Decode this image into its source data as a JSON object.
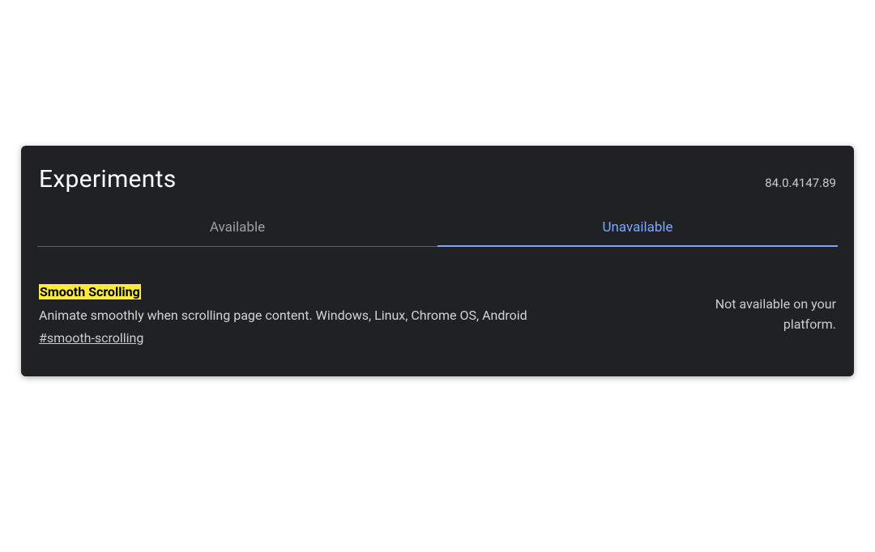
{
  "header": {
    "title": "Experiments",
    "version": "84.0.4147.89"
  },
  "tabs": {
    "available": "Available",
    "unavailable": "Unavailable",
    "active": "unavailable"
  },
  "flag": {
    "title": "Smooth Scrolling",
    "description": "Animate smoothly when scrolling page content. Windows, Linux, Chrome OS, Android",
    "hash": "#smooth-scrolling",
    "status": "Not available on your platform."
  }
}
